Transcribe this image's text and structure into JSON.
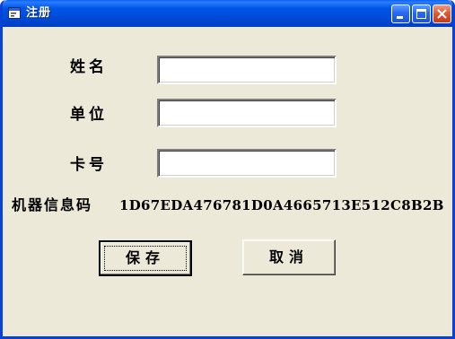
{
  "window": {
    "title": "注册"
  },
  "form": {
    "name_label": "姓名",
    "name_value": "",
    "unit_label": "单位",
    "unit_value": "",
    "card_label": "卡号",
    "card_value": "",
    "machine_label": "机器信息码",
    "machine_value": "1D67EDA476781D0A4665713E512C8B2B"
  },
  "buttons": {
    "save_label": "保存",
    "cancel_label": "取消"
  },
  "colors": {
    "titlebar": "#0054E3",
    "window_bg": "#ECE9D8",
    "close_button": "#DC5A3A"
  },
  "icons": {
    "title_icon": "app-window-icon",
    "minimize": "minimize-icon",
    "maximize": "maximize-icon",
    "close": "close-icon"
  }
}
